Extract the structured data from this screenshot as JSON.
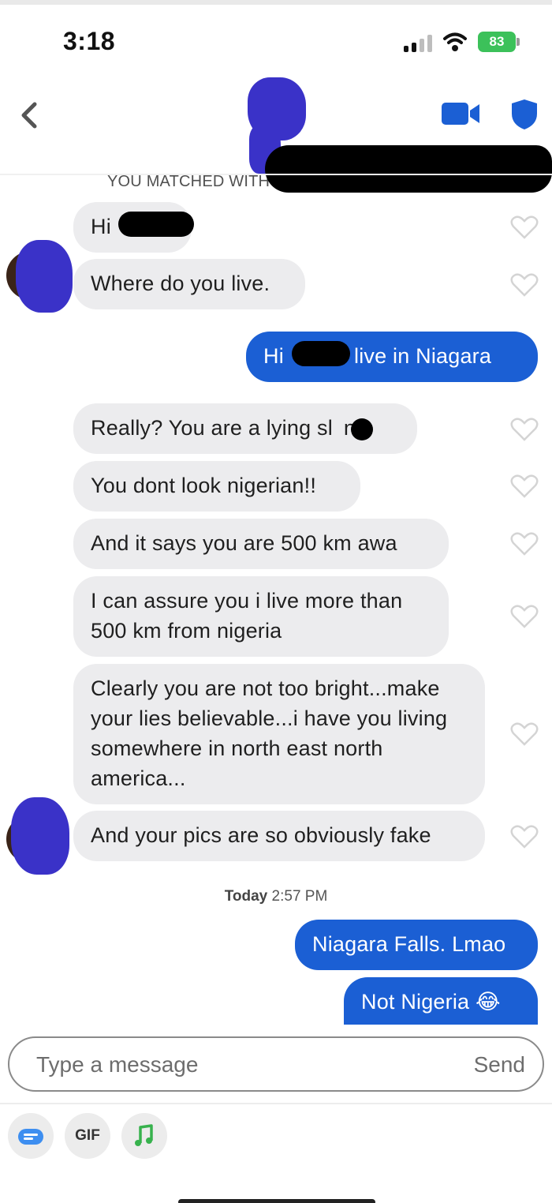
{
  "status_bar": {
    "time": "3:18",
    "battery": "83"
  },
  "header": {
    "banner": "YOU MATCHED WITH"
  },
  "messages": {
    "m1": "Hi",
    "m2": "Where do you live.",
    "m3_pre": "Hi",
    "m3_post": ".I live in Niagara",
    "m4": "Really? You are a lying sl",
    "m4_end": "nk",
    "m5": "You dont look nigerian!!",
    "m6": "And it says you are 500 km awa",
    "m7": "I can assure you i live more than 500 km from nigeria",
    "m8": "Clearly you are not too bright...make your lies believable...i have you living somewhere in north east north america...",
    "m9": "And your pics are so obviously fake",
    "m10": "Niagara Falls. Lmao",
    "m11": "Not Nigeria 😂"
  },
  "timestamp": {
    "day": "Today",
    "time": "2:57 PM"
  },
  "composer": {
    "placeholder": "Type a message",
    "send_label": "Send"
  },
  "toolbar": {
    "gif_label": "GIF"
  },
  "colors": {
    "accent": "#1b5fd4",
    "incoming_bubble": "#ececee",
    "redaction_avatar": "#3a32c8"
  },
  "icons": [
    "chevron-left-icon",
    "video-call-icon",
    "shield-icon",
    "heart-icon",
    "sticker-icon",
    "music-icon"
  ]
}
